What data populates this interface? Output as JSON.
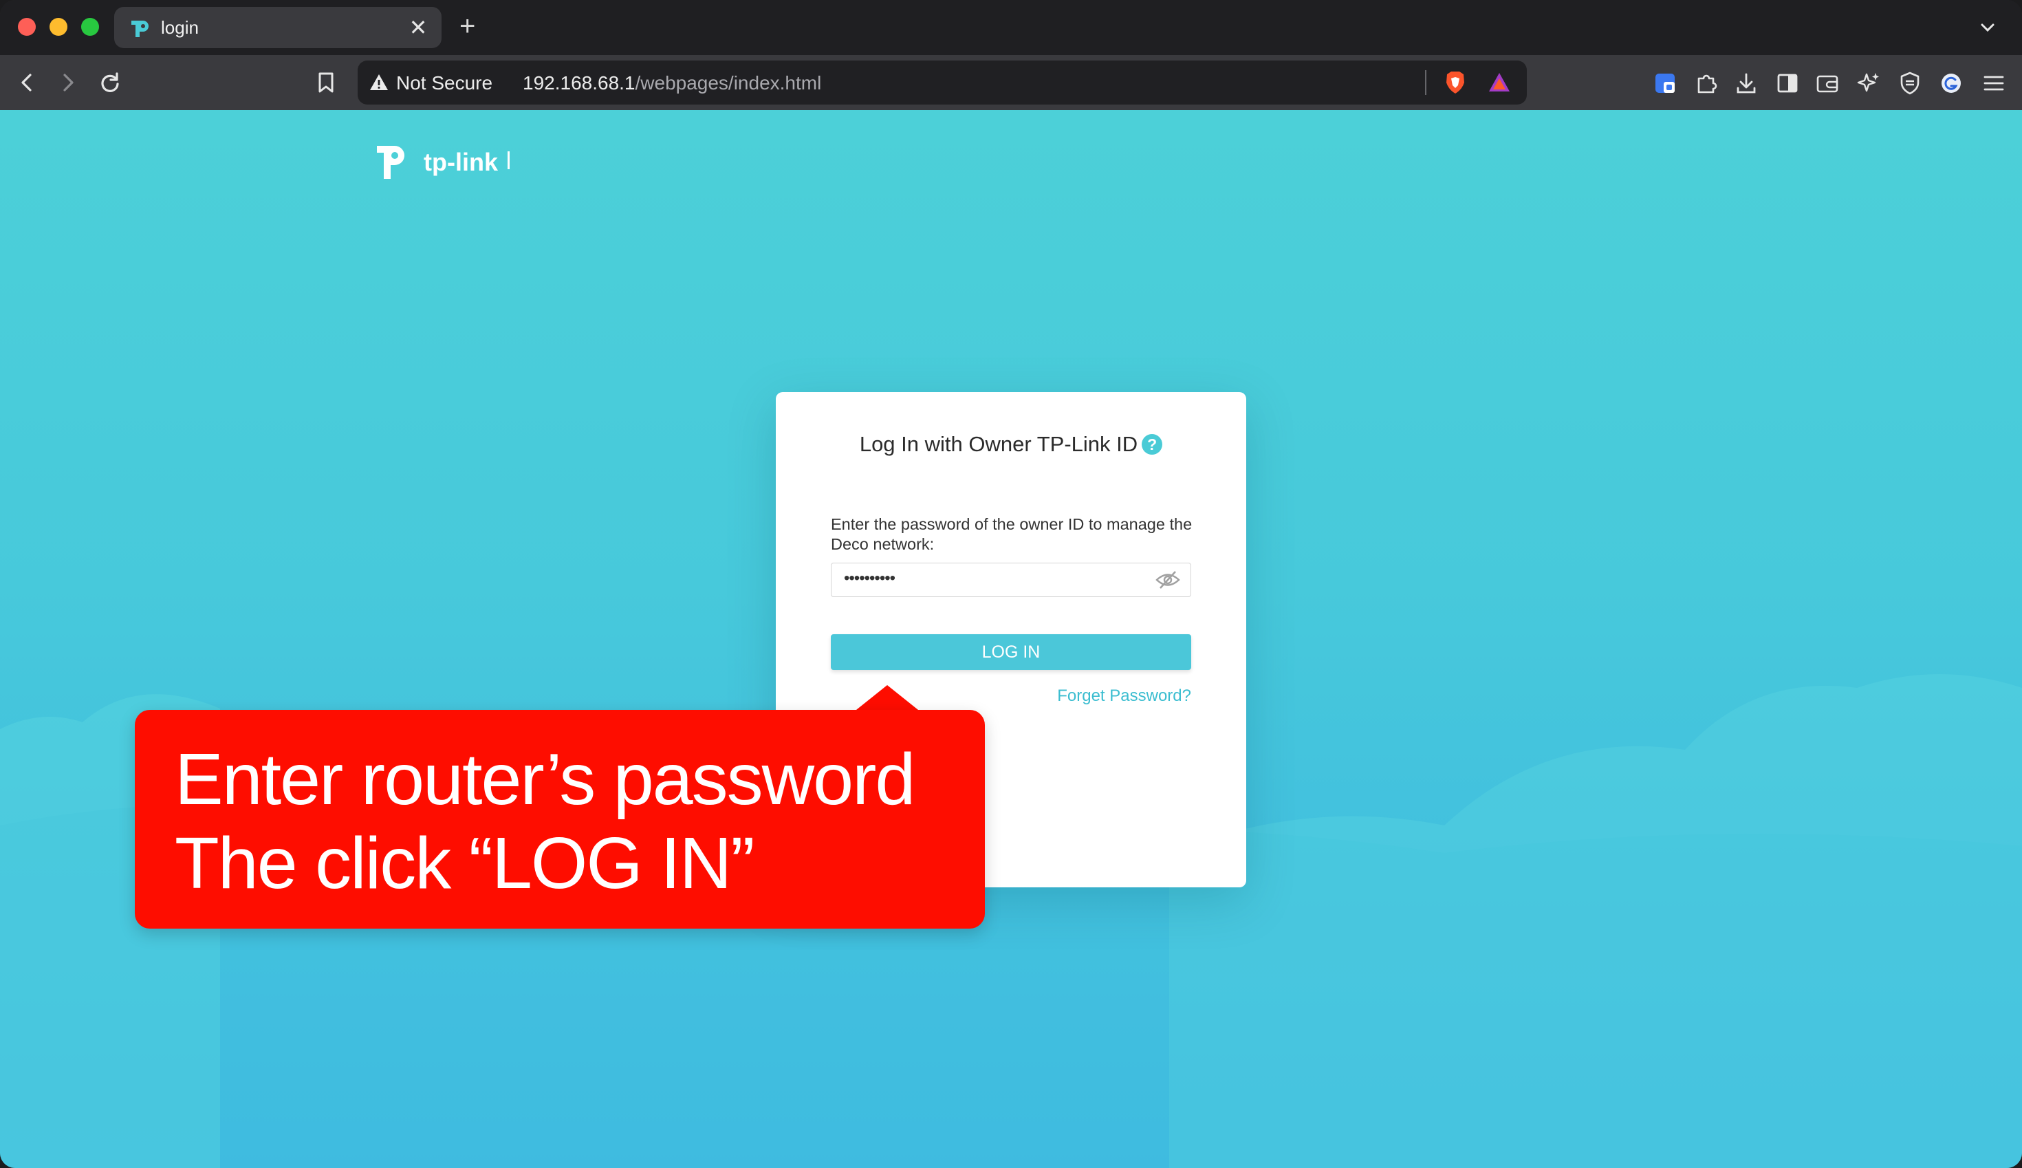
{
  "browser": {
    "tab": {
      "title": "login",
      "close_glyph": "✕"
    },
    "new_tab_glyph": "+",
    "omnibox": {
      "security_label": "Not Secure",
      "url_host": "192.168.68.1",
      "url_path": "/webpages/index.html"
    },
    "icons": {
      "back": "chevron-left-icon",
      "forward": "chevron-right-icon",
      "reload": "reload-icon",
      "bookmark": "bookmark-icon",
      "extensions": [
        "bitwarden-icon",
        "puzzle-icon",
        "download-icon",
        "sidebar-icon",
        "wallet-icon",
        "leo-ai-icon",
        "vpn-shield-icon",
        "grammarly-icon",
        "menu-icon"
      ]
    }
  },
  "page": {
    "brand": "tp-link",
    "login": {
      "title": "Log In with Owner TP-Link ID",
      "help_glyph": "?",
      "description": "Enter the password of the owner ID to manage the Deco network:",
      "password_mask": "••••••••••",
      "login_label": "LOG IN",
      "forget_label": "Forget Password?"
    },
    "callout": {
      "line1": "Enter router’s password",
      "line2": "The click “LOG IN”"
    }
  },
  "colors": {
    "accent": "#4bc7d9",
    "callout": "#fe0d00",
    "page_top": "#4cd0d8",
    "page_bottom": "#3cb6e2"
  }
}
